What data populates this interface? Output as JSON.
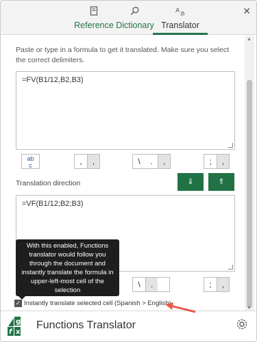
{
  "tabs": [
    {
      "label": "Reference",
      "icon": "reference-icon"
    },
    {
      "label": "Dictionary",
      "icon": "dictionary-icon"
    },
    {
      "label": "Translator",
      "icon": "translator-icon"
    }
  ],
  "active_tab": "Translator",
  "instructions": "Paste or type in a formula to get it translated. Make sure you select the correct delimiters.",
  "source_formula": "=FV(B1/12,B2,B3)",
  "target_formula": "=VF(B1/12;B2;B3)",
  "spell_check_label": "ab\nc",
  "delimiters": {
    "comma": [
      ",",
      ","
    ],
    "slash": [
      "\\",
      ".",
      ","
    ],
    "semicolon": [
      ";",
      ","
    ]
  },
  "delimiters_target": {
    "comma": [
      ",",
      "."
    ],
    "slash": [
      "\\",
      "."
    ],
    "semicolon": [
      ";",
      ","
    ]
  },
  "translation_direction_label": "Translation direction",
  "direction_down": "⇓",
  "direction_up": "⇑",
  "tooltip_text": "With this enabled, Functions translator would follow you through the document and instantly translate the formula in upper-left-most cell of the selection",
  "checkbox_label": "Instantly translate selected cell (Spanish > English)",
  "checkbox_checked": true,
  "footer_title": "Functions Translator",
  "colors": {
    "accent": "#217346",
    "annotation": "#e8584a"
  }
}
